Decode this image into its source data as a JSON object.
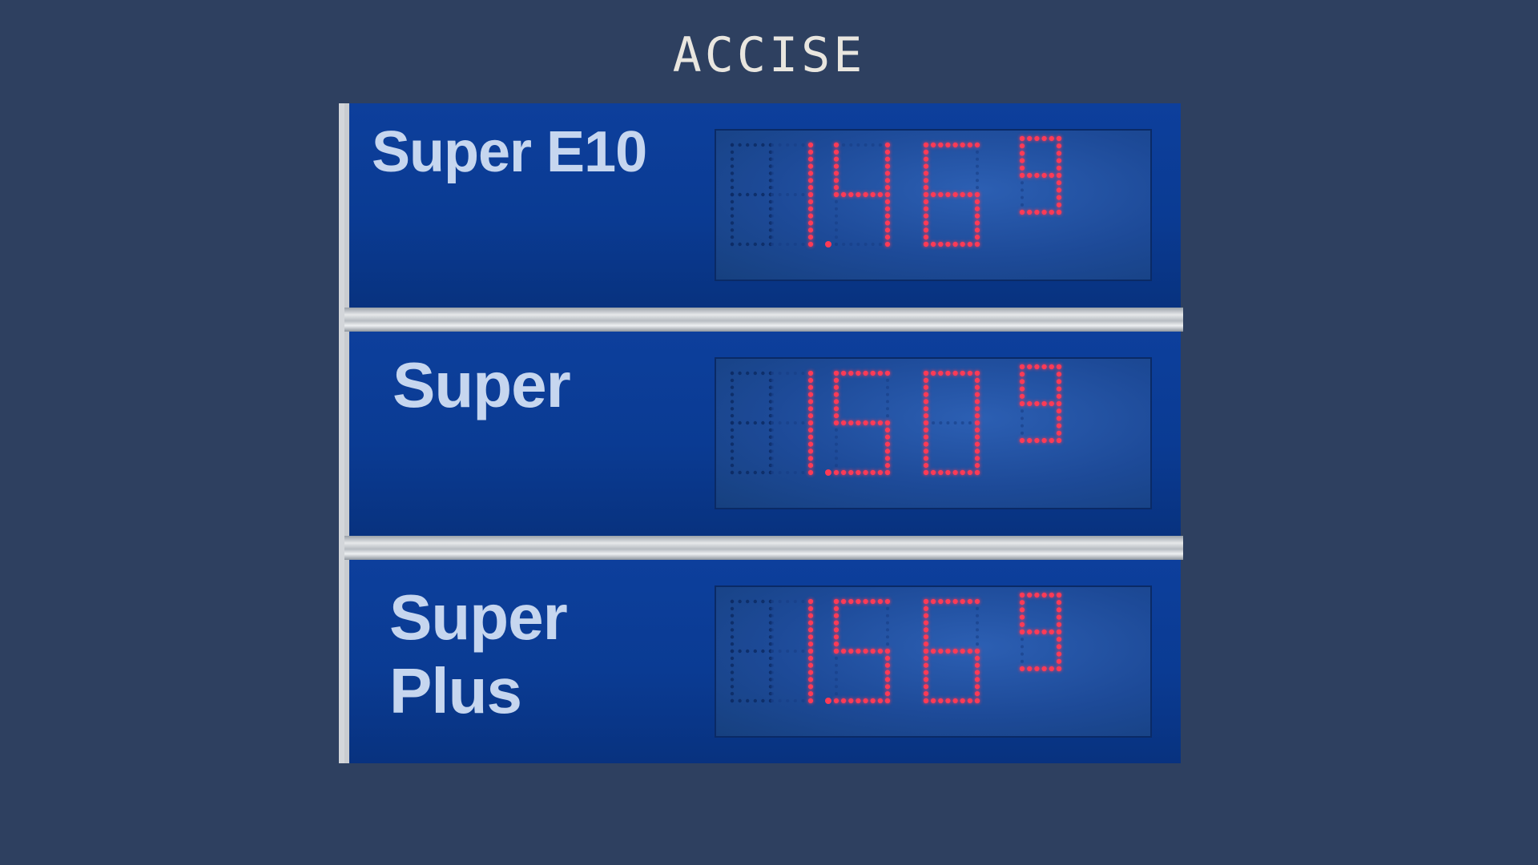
{
  "page": {
    "title": "ACCISE"
  },
  "board": {
    "rows": [
      {
        "label": "Super E10",
        "price": "1.469",
        "digits": [
          "1",
          "4",
          "6",
          "9"
        ]
      },
      {
        "label": "Super",
        "price": "1.509",
        "digits": [
          "1",
          "5",
          "0",
          "9"
        ]
      },
      {
        "label": "Super\nPlus",
        "price": "1.569",
        "digits": [
          "1",
          "5",
          "6",
          "9"
        ]
      }
    ]
  },
  "colors": {
    "background": "#2e4060",
    "panel_blue": "#0a3b93",
    "led_red": "#ff3a55",
    "label_text": "#c6d6ef"
  }
}
